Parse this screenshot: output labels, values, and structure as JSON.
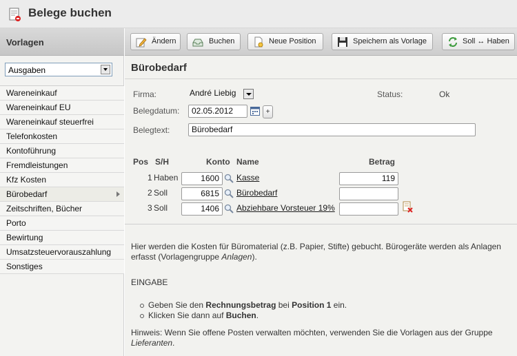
{
  "app": {
    "title": "Belege buchen"
  },
  "sidebar": {
    "header": "Vorlagen",
    "group_selected": "Ausgaben",
    "items": [
      "Wareneinkauf",
      "Wareneinkauf EU",
      "Wareneinkauf steuerfrei",
      "Telefonkosten",
      "Kontoführung",
      "Fremdleistungen",
      "Kfz Kosten",
      "Bürobedarf",
      "Zeitschriften, Bücher",
      "Porto",
      "Bewirtung",
      "Umsatzsteuervorauszahlung",
      "Sonstiges"
    ],
    "active_index": 7
  },
  "toolbar": {
    "edit": "Ändern",
    "book": "Buchen",
    "new_position": "Neue Position",
    "save_template": "Speichern als Vorlage",
    "swap": "Soll ↔ Haben"
  },
  "form": {
    "title": "Bürobedarf",
    "firma_label": "Firma:",
    "firma_value": "André Liebig",
    "status_label": "Status:",
    "status_value": "Ok",
    "date_label": "Belegdatum:",
    "date_value": "02.05.2012",
    "date_plus": "+",
    "text_label": "Belegtext:",
    "text_value": "Bürobedarf"
  },
  "positions": {
    "headers": {
      "pos": "Pos",
      "sh": "S/H",
      "konto": "Konto",
      "name": "Name",
      "betrag": "Betrag"
    },
    "rows": [
      {
        "pos": "1",
        "sh": "Haben",
        "konto": "1600",
        "name": "Kasse",
        "betrag": "119"
      },
      {
        "pos": "2",
        "sh": "Soll",
        "konto": "6815",
        "name": "Bürobedarf",
        "betrag": ""
      },
      {
        "pos": "3",
        "sh": "Soll",
        "konto": "1406",
        "name": "Abziehbare Vorsteuer 19%",
        "betrag": ""
      }
    ]
  },
  "help": {
    "intro_1": "Hier werden die Kosten für Büromaterial (z.B. Papier, Stifte) gebucht. Bürogeräte werden als Anlagen",
    "intro_2a": "erfasst (Vorlagengruppe ",
    "intro_2b": "Anlagen",
    "intro_2c": ").",
    "eingabe": "EINGABE",
    "b1a": "Geben Sie den ",
    "b1b": "Rechnungsbetrag",
    "b1c": " bei ",
    "b1d": "Position 1",
    "b1e": " ein.",
    "b2a": "Klicken Sie dann auf ",
    "b2b": "Buchen",
    "b2c": ".",
    "hint_1": "Hinweis: Wenn Sie offene Posten verwalten möchten, verwenden Sie die Vorlagen aus der Gruppe",
    "hint_2": "Lieferanten",
    "hint_3": "."
  }
}
